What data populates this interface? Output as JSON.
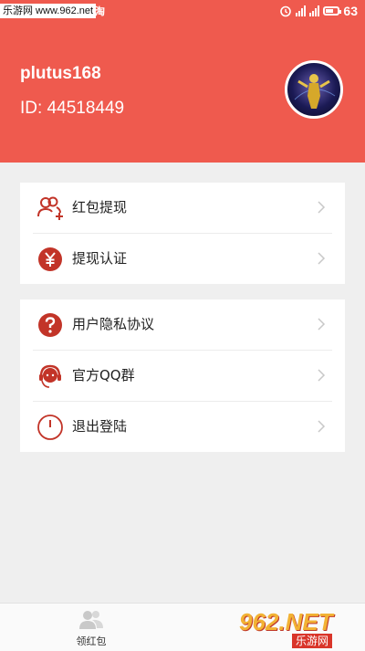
{
  "status_bar": {
    "watermark": "乐游网 www.962.net",
    "carrier_glyph": "淘",
    "battery_level": "63",
    "battery_fill_fraction": 0.63
  },
  "profile": {
    "username": "plutus168",
    "user_id": "ID: 44518449"
  },
  "menu": {
    "withdraw": "红包提现",
    "withdraw_verify": "提现认证",
    "privacy": "用户隐私协议",
    "qq_group": "官方QQ群",
    "logout": "退出登陆"
  },
  "tabbar": {
    "receive_red_packet": "领红包"
  },
  "logo": {
    "brand": "962.NET",
    "brand_cn": "乐游网"
  },
  "colors": {
    "header": "#ef5a4e",
    "icon_red": "#c23428",
    "background": "#efefef"
  },
  "icons": {
    "withdraw": "users-plus-icon",
    "withdraw_verify": "yen-circle-icon",
    "privacy": "question-circle-icon",
    "qq_group": "customer-service-icon",
    "logout": "power-icon"
  }
}
